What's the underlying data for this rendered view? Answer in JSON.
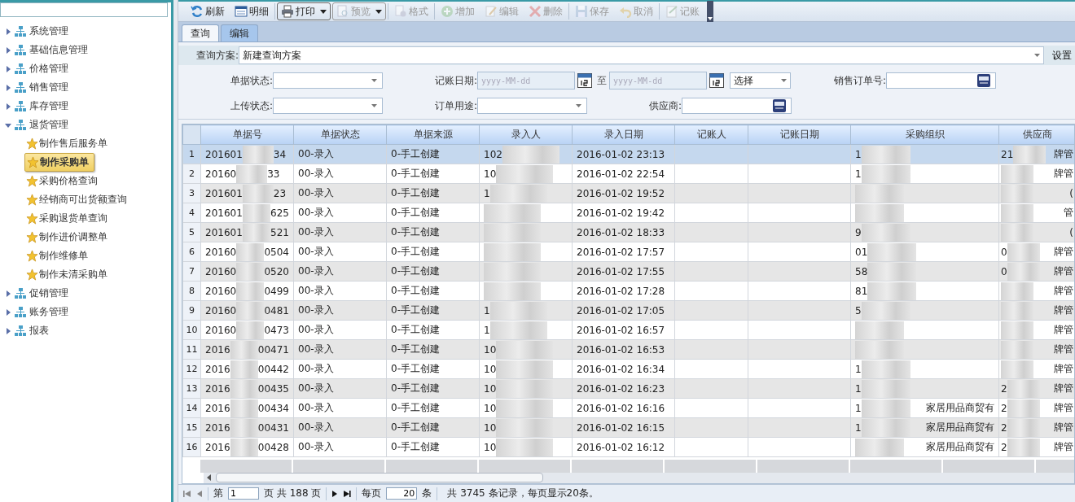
{
  "sidebar": {
    "tree": [
      {
        "label": "系统管理",
        "expanded": false
      },
      {
        "label": "基础信息管理",
        "expanded": false
      },
      {
        "label": "价格管理",
        "expanded": false
      },
      {
        "label": "销售管理",
        "expanded": false
      },
      {
        "label": "库存管理",
        "expanded": false
      },
      {
        "label": "退货管理",
        "expanded": true,
        "children": [
          {
            "label": "制作售后服务单",
            "selected": false
          },
          {
            "label": "制作采购单",
            "selected": true
          },
          {
            "label": "采购价格查询",
            "selected": false
          },
          {
            "label": "经销商可出货额查询",
            "selected": false
          },
          {
            "label": "采购退货单查询",
            "selected": false
          },
          {
            "label": "制作进价调整单",
            "selected": false
          },
          {
            "label": "制作维修单",
            "selected": false
          },
          {
            "label": "制作未清采购单",
            "selected": false
          }
        ]
      },
      {
        "label": "促销管理",
        "expanded": false
      },
      {
        "label": "账务管理",
        "expanded": false
      },
      {
        "label": "报表",
        "expanded": false
      }
    ]
  },
  "toolbar": [
    {
      "kind": "button",
      "label": "刷新",
      "disabled": false
    },
    {
      "kind": "button",
      "label": "明细",
      "disabled": false
    },
    {
      "kind": "split",
      "label": "打印",
      "disabled": false
    },
    {
      "kind": "split",
      "label": "预览",
      "disabled": true
    },
    {
      "kind": "button",
      "label": "格式",
      "disabled": true
    },
    {
      "kind": "button",
      "label": "增加",
      "disabled": true
    },
    {
      "kind": "button",
      "label": "编辑",
      "disabled": true
    },
    {
      "kind": "button",
      "label": "删除",
      "disabled": true
    },
    {
      "kind": "button",
      "label": "保存",
      "disabled": true
    },
    {
      "kind": "button",
      "label": "取消",
      "disabled": true
    },
    {
      "kind": "button",
      "label": "记账",
      "disabled": true
    }
  ],
  "tabs": [
    {
      "label": "查询",
      "selected": true
    },
    {
      "label": "编辑",
      "selected": false
    }
  ],
  "query_scheme": {
    "label": "查询方案:",
    "value": "新建查询方案",
    "settings_button": "设置"
  },
  "filters": [
    {
      "kind": "select",
      "label": "单据状态:"
    },
    {
      "kind": "date_range",
      "label": "记账日期:",
      "from_placeholder": "yyyy-MM-dd",
      "separator": "至",
      "to_placeholder": "yyyy-MM-dd",
      "mode": "选择"
    },
    {
      "kind": "lookup",
      "label": "销售订单号:"
    },
    {
      "kind": "select",
      "label": "上传状态:"
    },
    {
      "kind": "select",
      "label": "订单用途:"
    },
    {
      "kind": "lookup",
      "label": "供应商:"
    }
  ],
  "table": {
    "columns": [
      "单据号",
      "单据状态",
      "单据来源",
      "录入人",
      "录入日期",
      "记账人",
      "记账日期",
      "采购组织",
      "供应商"
    ],
    "rows": [
      {
        "index": "1",
        "no_a": "201601",
        "no_b": "34",
        "status": "00-录入",
        "source": "0-手工创建",
        "entered_by": "102",
        "date": "2016-01-02 23:13",
        "org_a": "1",
        "sup_a": "21",
        "sup_b": "牌管",
        "selected": true
      },
      {
        "index": "2",
        "no_a": "20160",
        "no_b": "33",
        "status": "00-录入",
        "source": "0-手工创建",
        "entered_by": "10",
        "date": "2016-01-02 22:54",
        "org_a": "1",
        "sup_b": "牌管",
        "selected": false
      },
      {
        "index": "3",
        "no_a": "201601",
        "no_b": "23",
        "status": "00-录入",
        "source": "0-手工创建",
        "entered_by": "1",
        "date": "2016-01-02 19:52",
        "sup_b": "(",
        "selected": false
      },
      {
        "index": "4",
        "no_a": "201601",
        "no_b": "625",
        "status": "00-录入",
        "source": "0-手工创建",
        "date": "2016-01-02 19:42",
        "sup_b": "管",
        "selected": false
      },
      {
        "index": "5",
        "no_a": "201601",
        "no_b": "521",
        "status": "00-录入",
        "source": "0-手工创建",
        "date": "2016-01-02 18:33",
        "org_a": "9",
        "sup_b": "(",
        "selected": false
      },
      {
        "index": "6",
        "no_a": "20160",
        "no_b": "0504",
        "status": "00-录入",
        "source": "0-手工创建",
        "date": "2016-01-02 17:57",
        "org_a": "01",
        "sup_a": "0",
        "sup_b": "牌管",
        "selected": false
      },
      {
        "index": "7",
        "no_a": "20160",
        "no_b": "0520",
        "status": "00-录入",
        "source": "0-手工创建",
        "date": "2016-01-02 17:55",
        "org_a": "58",
        "sup_a": "0",
        "sup_b": "牌管",
        "selected": false
      },
      {
        "index": "8",
        "no_a": "20160",
        "no_b": "0499",
        "status": "00-录入",
        "source": "0-手工创建",
        "date": "2016-01-02 17:28",
        "org_a": "81",
        "sup_b": "牌管",
        "selected": false
      },
      {
        "index": "9",
        "no_a": "20160",
        "no_b": "0481",
        "status": "00-录入",
        "source": "0-手工创建",
        "entered_by": "1",
        "date": "2016-01-02 17:05",
        "org_a": "5",
        "sup_b": "牌管",
        "selected": false
      },
      {
        "index": "10",
        "no_a": "20160",
        "no_b": "0473",
        "status": "00-录入",
        "source": "0-手工创建",
        "entered_by": "1",
        "date": "2016-01-02 16:57",
        "sup_b": "牌管",
        "selected": false
      },
      {
        "index": "11",
        "no_a": "2016",
        "no_b": "00471",
        "status": "00-录入",
        "source": "0-手工创建",
        "entered_by": "10",
        "date": "2016-01-02 16:53",
        "sup_b": "牌管",
        "selected": false
      },
      {
        "index": "12",
        "no_a": "2016",
        "no_b": "00442",
        "status": "00-录入",
        "source": "0-手工创建",
        "entered_by": "10",
        "date": "2016-01-02 16:34",
        "org_a": "1",
        "sup_b": "牌管",
        "selected": false
      },
      {
        "index": "13",
        "no_a": "2016",
        "no_b": "00435",
        "status": "00-录入",
        "source": "0-手工创建",
        "entered_by": "10",
        "date": "2016-01-02 16:23",
        "org_a": "1",
        "sup_a": "2",
        "sup_b": "牌管",
        "selected": false
      },
      {
        "index": "14",
        "no_a": "2016",
        "no_b": "00434",
        "status": "00-录入",
        "source": "0-手工创建",
        "entered_by": "10",
        "date": "2016-01-02 16:16",
        "org_a": "1",
        "org_b": "家居用品商贸有",
        "sup_a": "2",
        "sup_b": "牌管",
        "selected": false
      },
      {
        "index": "15",
        "no_a": "2016",
        "no_b": "00431",
        "status": "00-录入",
        "source": "0-手工创建",
        "entered_by": "10",
        "date": "2016-01-02 16:15",
        "org_a": "1",
        "org_b": "家居用品商贸有",
        "sup_a": "2",
        "sup_b": "牌管",
        "selected": false
      },
      {
        "index": "16",
        "no_a": "2016",
        "no_b": "00428",
        "status": "00-录入",
        "source": "0-手工创建",
        "entered_by": "10",
        "date": "2016-01-02 16:12",
        "org_b": "家居用品商贸有",
        "sup_a": "2",
        "sup_b": "牌管",
        "selected": false
      }
    ]
  },
  "pager": {
    "page_prefix": "第",
    "page": "1",
    "page_suffix": "页 共 188 页",
    "per_page_label": "每页",
    "per_page": "20",
    "per_page_unit": "条",
    "summary": "共 3745 条记录，每页显示20条。"
  }
}
